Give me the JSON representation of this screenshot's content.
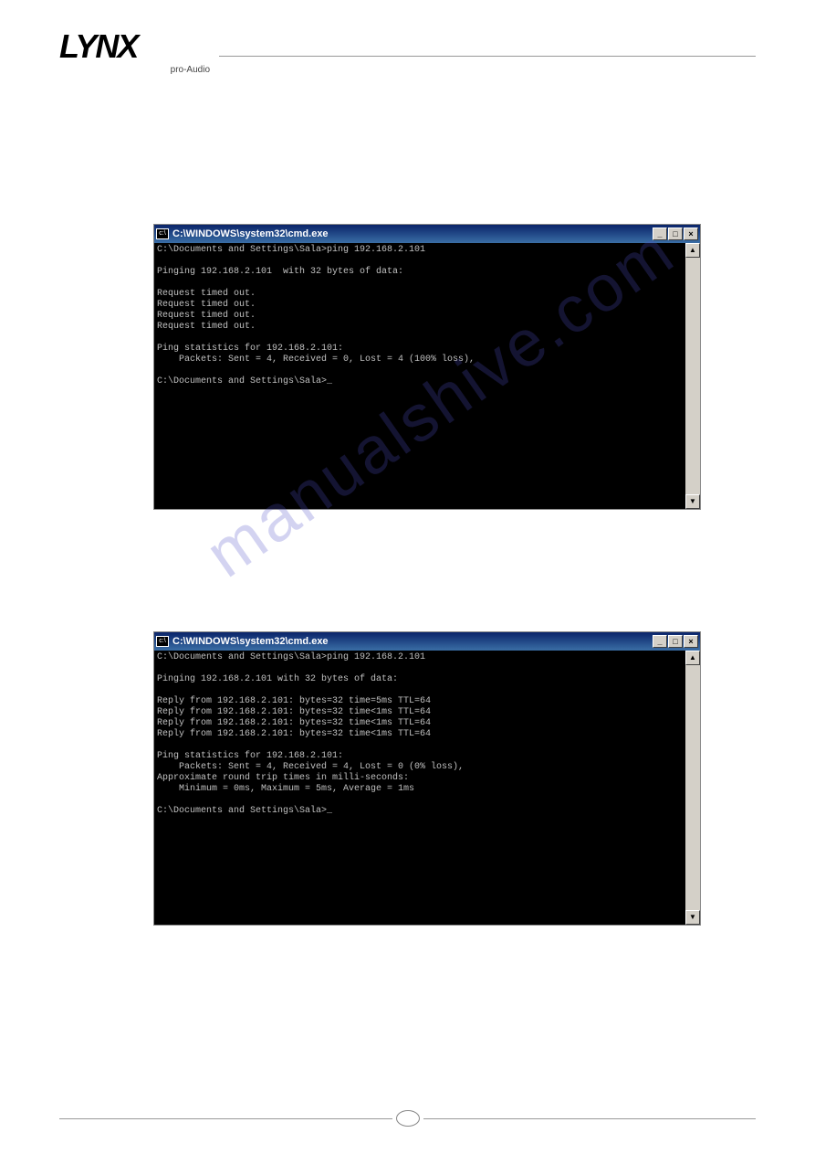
{
  "logo": {
    "main": "LYNX",
    "sub": "pro-Audio"
  },
  "watermark": "manualshive.com",
  "cmdWindows": [
    {
      "title": "C:\\WINDOWS\\system32\\cmd.exe",
      "buttons": {
        "min": "_",
        "max": "□",
        "close": "×"
      },
      "scroll": {
        "up": "▲",
        "down": "▼"
      },
      "content": "C:\\Documents and Settings\\Sala>ping 192.168.2.101\n\nPinging 192.168.2.101  with 32 bytes of data:\n\nRequest timed out.\nRequest timed out.\nRequest timed out.\nRequest timed out.\n\nPing statistics for 192.168.2.101:\n    Packets: Sent = 4, Received = 0, Lost = 4 (100% loss),\n\nC:\\Documents and Settings\\Sala>_"
    },
    {
      "title": "C:\\WINDOWS\\system32\\cmd.exe",
      "buttons": {
        "min": "_",
        "max": "□",
        "close": "×"
      },
      "scroll": {
        "up": "▲",
        "down": "▼"
      },
      "content": "C:\\Documents and Settings\\Sala>ping 192.168.2.101\n\nPinging 192.168.2.101 with 32 bytes of data:\n\nReply from 192.168.2.101: bytes=32 time=5ms TTL=64\nReply from 192.168.2.101: bytes=32 time<1ms TTL=64\nReply from 192.168.2.101: bytes=32 time<1ms TTL=64\nReply from 192.168.2.101: bytes=32 time<1ms TTL=64\n\nPing statistics for 192.168.2.101:\n    Packets: Sent = 4, Received = 4, Lost = 0 (0% loss),\nApproximate round trip times in milli-seconds:\n    Minimum = 0ms, Maximum = 5ms, Average = 1ms\n\nC:\\Documents and Settings\\Sala>_"
    }
  ]
}
